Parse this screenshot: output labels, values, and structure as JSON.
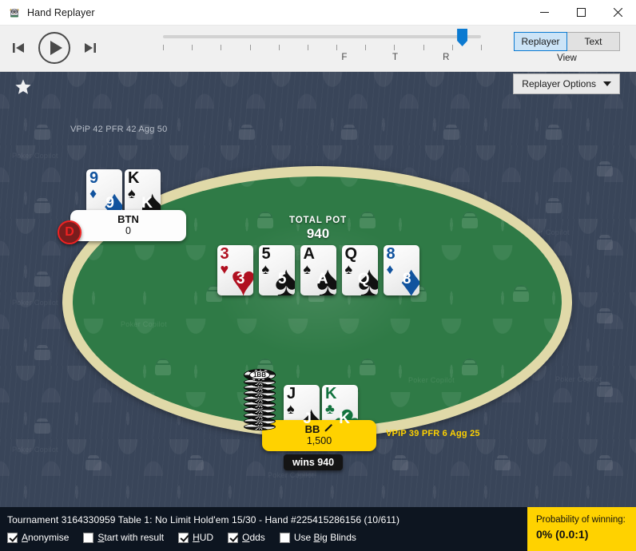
{
  "window": {
    "title": "Hand Replayer",
    "app_icon": "owl-app-icon",
    "minimize": "─",
    "maximize": "□",
    "close": "✕"
  },
  "toolbar": {
    "skip_back_label": "skip-to-start",
    "play_label": "play",
    "skip_forward_label": "skip-to-end",
    "slider": {
      "position_percent": 95,
      "tick_count": 12,
      "street_marks": [
        {
          "label": "F",
          "pos_percent": 57
        },
        {
          "label": "T",
          "pos_percent": 73
        },
        {
          "label": "R",
          "pos_percent": 89
        }
      ]
    },
    "view": {
      "label": "View",
      "options": [
        "Replayer",
        "Text"
      ],
      "selected": "Replayer"
    },
    "replayer_options_label": "Replayer Options"
  },
  "table": {
    "favorite_icon": "star-icon",
    "pot": {
      "label": "TOTAL POT",
      "value": "940"
    },
    "board": [
      {
        "rank": "3",
        "suit": "hearts",
        "glyph": "♥",
        "color": "red"
      },
      {
        "rank": "5",
        "suit": "spades",
        "glyph": "♠",
        "color": "black"
      },
      {
        "rank": "A",
        "suit": "spades",
        "glyph": "♠",
        "color": "black"
      },
      {
        "rank": "Q",
        "suit": "spades",
        "glyph": "♠",
        "color": "black"
      },
      {
        "rank": "8",
        "suit": "diamonds",
        "glyph": "♦",
        "color": "blue"
      }
    ]
  },
  "players": [
    {
      "id": "btn",
      "name": "BTN",
      "stack": "0",
      "hud": "VPiP 42  PFR 42  Agg 50",
      "is_dealer": true,
      "dealer_label": "D",
      "cards": [
        {
          "rank": "9",
          "suit": "diamonds",
          "glyph": "♦",
          "color": "blue"
        },
        {
          "rank": "K",
          "suit": "spades",
          "glyph": "♠",
          "color": "black"
        }
      ]
    },
    {
      "id": "bb",
      "name": "BB",
      "stack": "1,500",
      "hud": "VPiP 39  PFR 6  Agg 25",
      "edit_icon": "pencil-icon",
      "wins_badge": "wins 940",
      "bet_chip_label": "1BB",
      "cards": [
        {
          "rank": "J",
          "suit": "spades",
          "glyph": "♠",
          "color": "black"
        },
        {
          "rank": "K",
          "suit": "clubs",
          "glyph": "♣",
          "color": "green"
        }
      ]
    }
  ],
  "statusbar": {
    "hand_info": "Tournament 3164330959 Table 1: No Limit Hold'em 15/30 - Hand #225415286156 (10/611)",
    "checkboxes": [
      {
        "label": "Anonymise",
        "accel": "A",
        "checked": true
      },
      {
        "label": "Start with result",
        "accel": "S",
        "checked": false
      },
      {
        "label": "HUD",
        "accel": "H",
        "checked": true
      },
      {
        "label": "Odds",
        "accel": "O",
        "checked": true
      },
      {
        "label": "Use Big Blinds",
        "accel": "B",
        "checked": false
      }
    ]
  },
  "probability": {
    "title": "Probability of winning:",
    "value": "0% (0.0:1)"
  },
  "watermark": "Poker Copilot",
  "colors": {
    "accent": "#0b7ad1",
    "gold": "#ffd200",
    "felt": "#2f7a46",
    "rail": "#e0d9a8",
    "bg": "#394559"
  }
}
